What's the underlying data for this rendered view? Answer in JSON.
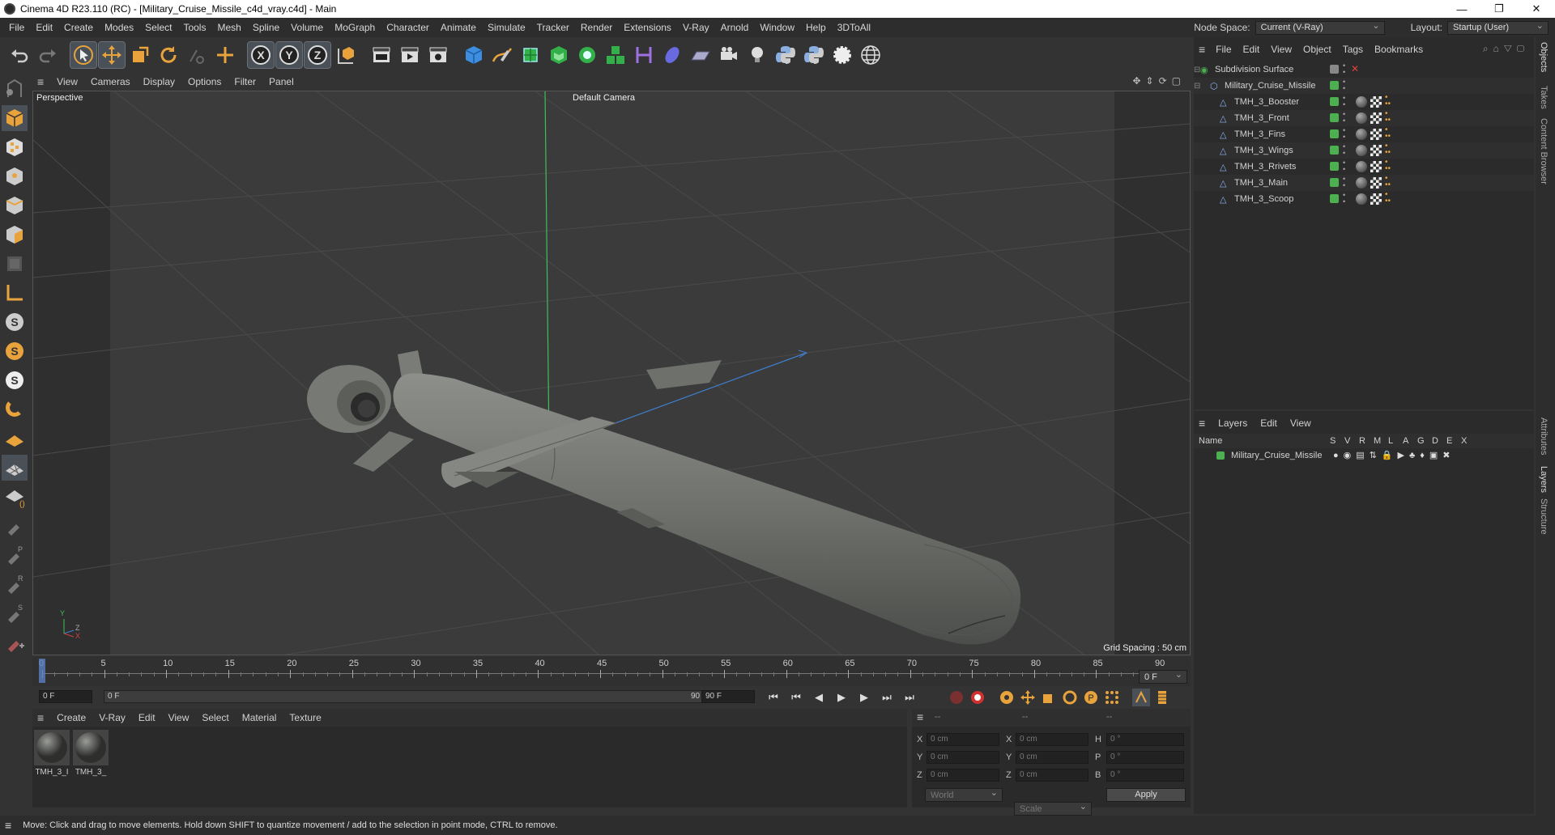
{
  "window": {
    "title": "Cinema 4D R23.110 (RC) - [Military_Cruise_Missile_c4d_vray.c4d] - Main",
    "min": "—",
    "max": "❐",
    "close": "✕"
  },
  "menu": [
    "File",
    "Edit",
    "Create",
    "Modes",
    "Select",
    "Tools",
    "Mesh",
    "Spline",
    "Volume",
    "MoGraph",
    "Character",
    "Animate",
    "Simulate",
    "Tracker",
    "Render",
    "Extensions",
    "V-Ray",
    "Arnold",
    "Window",
    "Help",
    "3DToAll"
  ],
  "nodespace": {
    "label": "Node Space:",
    "value": "Current (V-Ray)"
  },
  "layout": {
    "label": "Layout:",
    "value": "Startup (User)"
  },
  "viewport": {
    "menu": [
      "View",
      "Cameras",
      "Display",
      "Options",
      "Filter",
      "Panel"
    ],
    "name": "Perspective",
    "camera": "Default Camera",
    "grid": "Grid Spacing : 50 cm",
    "axes": {
      "y": "Y",
      "z": "Z",
      "x": "X"
    }
  },
  "timeline": {
    "ticks": [
      "0",
      "5",
      "10",
      "15",
      "20",
      "25",
      "30",
      "35",
      "40",
      "45",
      "50",
      "55",
      "60",
      "65",
      "70",
      "75",
      "80",
      "85",
      "90"
    ],
    "frame_right": "0 F"
  },
  "playbar": {
    "start": "0 F",
    "cur": "0 F",
    "end_in": "90 F",
    "end": "90 F"
  },
  "materials": {
    "menu": [
      "Create",
      "V-Ray",
      "Edit",
      "View",
      "Select",
      "Material",
      "Texture"
    ],
    "items": [
      "TMH_3_I",
      "TMH_3_"
    ]
  },
  "coords": {
    "headers": [
      "--",
      "--",
      "--"
    ],
    "rows": [
      {
        "a": "X",
        "av": "0 cm",
        "b": "X",
        "bv": "0 cm",
        "c": "H",
        "cv": "0 °"
      },
      {
        "a": "Y",
        "av": "0 cm",
        "b": "Y",
        "bv": "0 cm",
        "c": "P",
        "cv": "0 °"
      },
      {
        "a": "Z",
        "av": "0 cm",
        "b": "Z",
        "bv": "0 cm",
        "c": "B",
        "cv": "0 °"
      }
    ],
    "world": "World",
    "scale": "Scale",
    "apply": "Apply"
  },
  "objects": {
    "menu": [
      "File",
      "Edit",
      "View",
      "Object",
      "Tags",
      "Bookmarks"
    ],
    "items": [
      {
        "name": "Subdivision Surface",
        "indent": 0
      },
      {
        "name": "Military_Cruise_Missile",
        "indent": 1
      },
      {
        "name": "TMH_3_Booster",
        "indent": 2
      },
      {
        "name": "TMH_3_Front",
        "indent": 2
      },
      {
        "name": "TMH_3_Fins",
        "indent": 2
      },
      {
        "name": "TMH_3_Wings",
        "indent": 2
      },
      {
        "name": "TMH_3_Rrivets",
        "indent": 2
      },
      {
        "name": "TMH_3_Main",
        "indent": 2
      },
      {
        "name": "TMH_3_Scoop",
        "indent": 2
      }
    ]
  },
  "layers": {
    "menu": [
      "Layers",
      "Edit",
      "View"
    ],
    "col_name": "Name",
    "cols": [
      "S",
      "V",
      "R",
      "M",
      "L",
      "A",
      "G",
      "D",
      "E",
      "X"
    ],
    "items": [
      "Military_Cruise_Missile"
    ]
  },
  "sidetabs": [
    "Objects",
    "Takes",
    "Content Browser",
    "Attributes",
    "Layers",
    "Structure"
  ],
  "status": "Move: Click and drag to move elements. Hold down SHIFT to quantize movement / add to the selection in point mode, CTRL to remove.",
  "colors": {
    "accent": "#e8a33c",
    "green": "#4caf50",
    "selection": "#5a6a80"
  }
}
